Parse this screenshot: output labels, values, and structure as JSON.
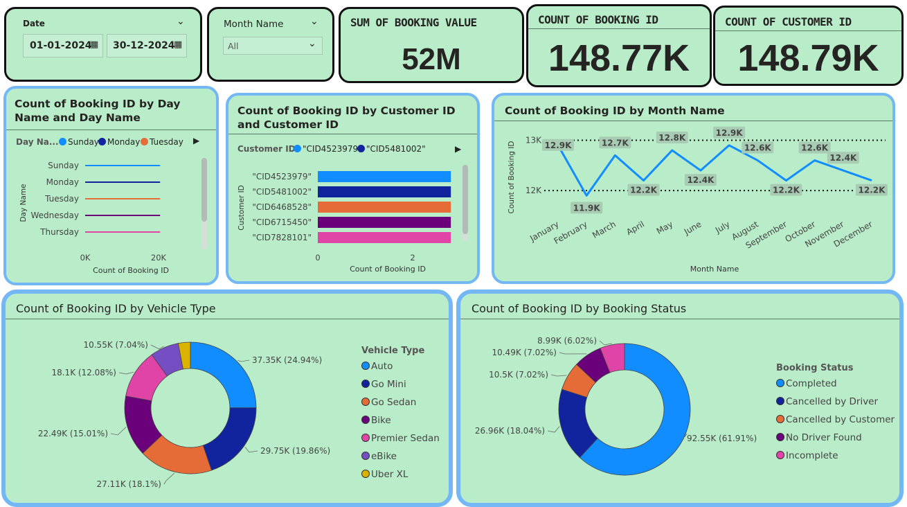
{
  "filters": {
    "date": {
      "label": "Date",
      "start": "01-01-2024",
      "end": "30-12-2024"
    },
    "month": {
      "label": "Month Name",
      "value": "All"
    }
  },
  "kpis": [
    {
      "title": "SUM OF BOOKING VALUE",
      "value": "52M"
    },
    {
      "title": "COUNT OF BOOKING ID",
      "value": "148.77K"
    },
    {
      "title": "COUNT OF CUSTOMER ID",
      "value": "148.79K"
    }
  ],
  "colors": {
    "blue": "#118dff",
    "navy": "#12239e",
    "orange": "#e66c37",
    "purple": "#6b007b",
    "pink": "#e044a7",
    "violet": "#744ec2",
    "gold": "#d9b300"
  },
  "chart_data": [
    {
      "type": "bar",
      "title": "Count of Booking ID by Day Name and Day Name",
      "legend_title": "Day Na...",
      "legend": [
        "Sunday",
        "Monday",
        "Tuesday"
      ],
      "categories": [
        "Sunday",
        "Monday",
        "Tuesday",
        "Wednesday",
        "Thursday"
      ],
      "values": [
        21300,
        21300,
        21300,
        21300,
        21300
      ],
      "ylabel": "Day Name",
      "xlabel": "Count of Booking ID",
      "ticks": [
        "0K",
        "20K"
      ],
      "xlim": [
        0,
        25000
      ]
    },
    {
      "type": "bar",
      "title": "Count of Booking ID by Customer ID and Customer ID",
      "legend_title": "Customer ID",
      "legend": [
        "\"CID4523979\"",
        "\"CID5481002\""
      ],
      "categories": [
        "\"CID4523979\"",
        "\"CID5481002\"",
        "\"CID6468528\"",
        "\"CID6715450\"",
        "\"CID7828101\""
      ],
      "values": [
        3,
        3,
        3,
        3,
        3
      ],
      "ylabel": "Customer ID",
      "xlabel": "Count of Booking ID",
      "ticks": [
        "0",
        "2"
      ],
      "xlim": [
        0,
        3.2
      ]
    },
    {
      "type": "line",
      "title": "Count of Booking ID by Month Name",
      "categories": [
        "January",
        "February",
        "March",
        "April",
        "May",
        "June",
        "July",
        "August",
        "September",
        "October",
        "November",
        "December"
      ],
      "values": [
        12.9,
        11.9,
        12.7,
        12.2,
        12.8,
        12.4,
        12.9,
        12.6,
        12.2,
        12.6,
        12.4,
        12.2
      ],
      "labels": [
        "12.9K",
        "11.9K",
        "12.7K",
        "12.2K",
        "12.8K",
        "12.4K",
        "12.9K",
        "12.6K",
        "12.2K",
        "12.6K",
        "12.4K",
        "12.2K"
      ],
      "ylabel": "Count of Booking ID",
      "xlabel": "Month Name",
      "yticks": [
        "12K",
        "13K"
      ],
      "ylim": [
        11.85,
        13.2
      ]
    },
    {
      "type": "pie",
      "title": "Count of Booking ID by Vehicle Type",
      "legend_title": "Vehicle Type",
      "slices": [
        {
          "name": "Auto",
          "value": 24.94,
          "label": "37.35K (24.94%)"
        },
        {
          "name": "Go Mini",
          "value": 19.86,
          "label": "29.75K (19.86%)"
        },
        {
          "name": "Go Sedan",
          "value": 18.1,
          "label": "27.11K (18.1%)"
        },
        {
          "name": "Bike",
          "value": 15.01,
          "label": "22.49K (15.01%)"
        },
        {
          "name": "Premier Sedan",
          "value": 12.08,
          "label": "18.1K (12.08%)"
        },
        {
          "name": "eBike",
          "value": 7.04,
          "label": "10.55K (7.04%)"
        },
        {
          "name": "Uber XL",
          "value": 2.97,
          "label": ""
        }
      ]
    },
    {
      "type": "pie",
      "title": "Count of Booking ID by Booking Status",
      "legend_title": "Booking Status",
      "slices": [
        {
          "name": "Completed",
          "value": 61.91,
          "label": "92.55K (61.91%)"
        },
        {
          "name": "Cancelled by Driver",
          "value": 18.04,
          "label": "26.96K (18.04%)"
        },
        {
          "name": "Cancelled by Customer",
          "value": 7.02,
          "label": "10.5K (7.02%)"
        },
        {
          "name": "No Driver Found",
          "value": 7.02,
          "label": "10.49K (7.02%)"
        },
        {
          "name": "Incomplete",
          "value": 6.02,
          "label": "8.99K (6.02%)"
        }
      ]
    }
  ]
}
